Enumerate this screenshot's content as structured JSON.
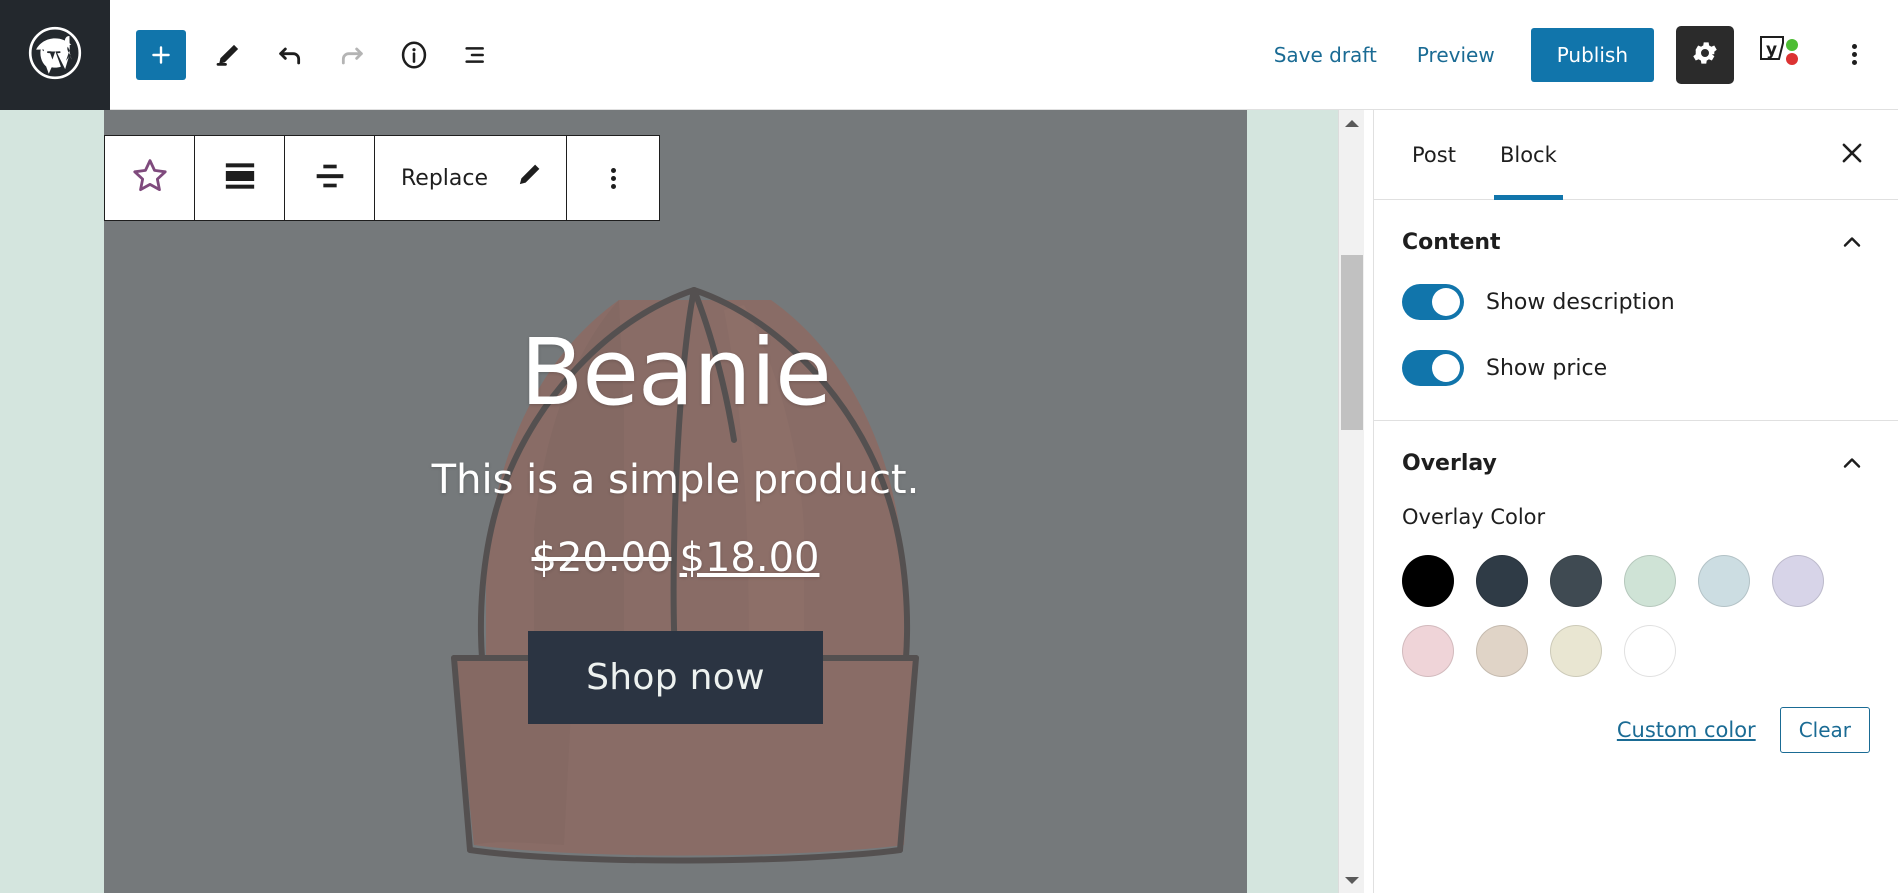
{
  "topbar": {
    "logo_icon": "wordpress-logo-icon",
    "tools": [
      {
        "name": "add-block-button",
        "icon": "plus-icon",
        "label": "Add block",
        "disabled": false
      },
      {
        "name": "edit-tool-button",
        "icon": "pencil-icon",
        "label": "Tools",
        "disabled": false
      },
      {
        "name": "undo-button",
        "icon": "undo-arrow-icon",
        "label": "Undo",
        "disabled": false
      },
      {
        "name": "redo-button",
        "icon": "redo-arrow-icon",
        "label": "Redo",
        "disabled": true
      },
      {
        "name": "details-button",
        "icon": "info-circle-icon",
        "label": "Details",
        "disabled": false
      },
      {
        "name": "list-view-button",
        "icon": "list-view-icon",
        "label": "List view",
        "disabled": false
      }
    ],
    "save_draft_label": "Save draft",
    "preview_label": "Preview",
    "publish_label": "Publish",
    "settings_icon": "gear-icon",
    "yoast_icon": "yoast-seo-icon",
    "options_icon": "kebab-menu-icon",
    "accent_color": "#1175ab",
    "link_color": "#1a6b94"
  },
  "block_toolbar": {
    "items": [
      {
        "name": "block-type-star-icon",
        "icon": "star-outline-icon",
        "label": ""
      },
      {
        "name": "cover-block-icon",
        "icon": "cover-block-icon",
        "label": ""
      },
      {
        "name": "align-button",
        "icon": "align-center-icon",
        "label": ""
      }
    ],
    "replace_label": "Replace",
    "replace_edit_icon": "pencil-icon",
    "more_options_icon": "kebab-menu-icon"
  },
  "cover": {
    "title": "Beanie",
    "description": "This is a simple product.",
    "price_old": "$20.00",
    "price_new": "$18.00",
    "button_label": "Shop now",
    "overlay_color": "#7c8082",
    "button_color": "#2b3442",
    "canvas_background": "#d4e5de"
  },
  "sidebar": {
    "tabs": [
      {
        "label": "Post",
        "active": false
      },
      {
        "label": "Block",
        "active": true
      }
    ],
    "close_icon": "close-icon",
    "panels": [
      {
        "title": "Content",
        "collapse_icon": "chevron-up-icon",
        "toggles": [
          {
            "label": "Show description",
            "on": true
          },
          {
            "label": "Show price",
            "on": true
          }
        ]
      },
      {
        "title": "Overlay",
        "collapse_icon": "chevron-up-icon",
        "color_label": "Overlay Color",
        "swatches": [
          "#000000",
          "#2f3b46",
          "#3f4a52",
          "#cfe3d6",
          "#ccdde2",
          "#d7d4e8",
          "#efd4d8",
          "#e0d4c7",
          "#e9e6d2",
          "#ffffff"
        ],
        "custom_color_label": "Custom color",
        "clear_label": "Clear"
      }
    ]
  },
  "scrollbar": {
    "up_icon": "caret-up-icon",
    "down_icon": "caret-down-icon"
  }
}
